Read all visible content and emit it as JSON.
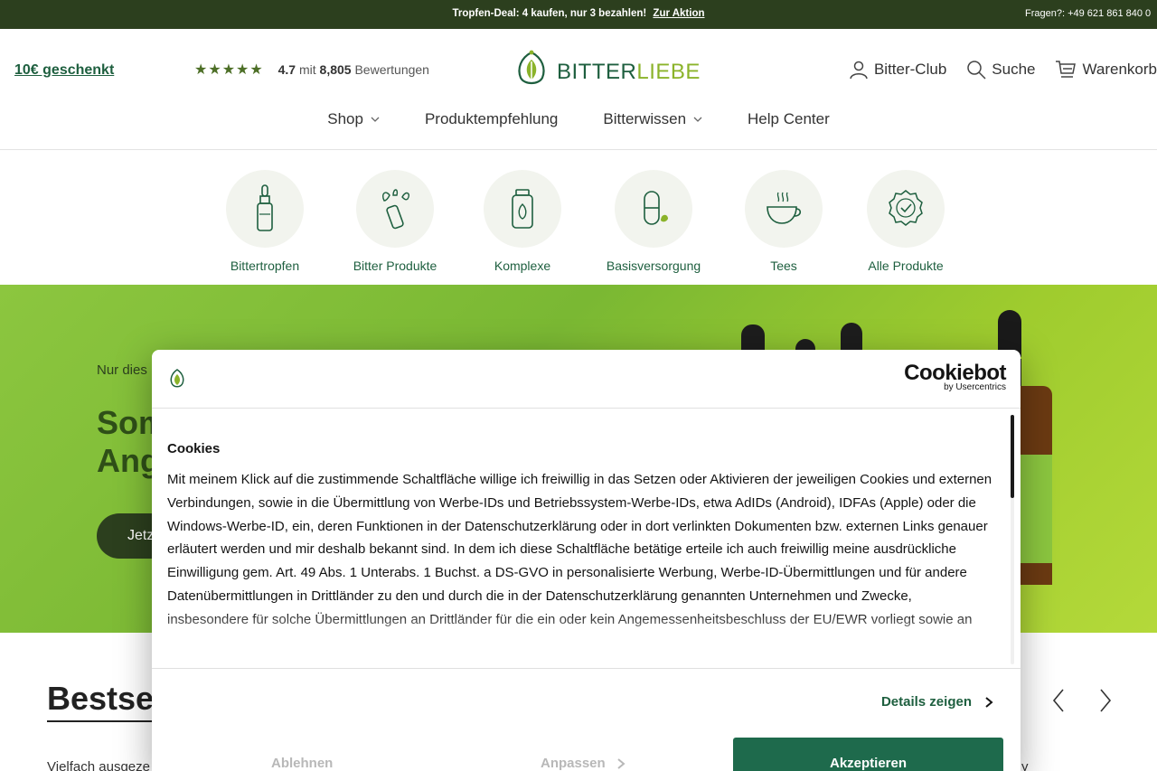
{
  "topbar": {
    "promo_text": "Tropfen-Deal: 4 kaufen, nur 3 bezahlen!",
    "promo_link": "Zur Aktion",
    "phone": "Fragen?: +49 621 861 840 0"
  },
  "header": {
    "gift_link": "10€ geschenkt",
    "rating_stars": "★★★★★",
    "rating_value": "4.7",
    "rating_mid": "mit",
    "rating_count": "8,805",
    "rating_suffix": "Bewertungen",
    "logo_part1": "BITTER",
    "logo_part2": "LIEBE",
    "actions": {
      "club": "Bitter-Club",
      "search": "Suche",
      "cart": "Warenkorb"
    },
    "nav": {
      "shop": "Shop",
      "recommendation": "Produktempfehlung",
      "knowledge": "Bitterwissen",
      "help": "Help Center"
    }
  },
  "categories": [
    {
      "label": "Bittertropfen",
      "icon": "dropper-bottle-icon"
    },
    {
      "label": "Bitter Produkte",
      "icon": "spray-leaves-icon"
    },
    {
      "label": "Komplexe",
      "icon": "jar-leaf-icon"
    },
    {
      "label": "Basisversorgung",
      "icon": "capsule-leaf-icon"
    },
    {
      "label": "Tees",
      "icon": "tea-cup-icon"
    },
    {
      "label": "Alle Produkte",
      "icon": "badge-check-icon"
    }
  ],
  "hero": {
    "eyebrow": "Nur dies",
    "headline_line1": "Som",
    "headline_line2": "Ang",
    "cta": "Jetz"
  },
  "bestseller": {
    "heading": "Bestsel",
    "subtext": "Vielfach ausgeze",
    "tail": "y"
  },
  "cookie_modal": {
    "brand": "Cookiebot",
    "brand_sub": "by Usercentrics",
    "title": "Cookies",
    "body": "Mit meinem Klick auf die zustimmende Schaltfläche willige ich freiwillig in das Setzen oder Aktivieren der jeweiligen Cookies und externen Verbindungen, sowie in die Übermittlung von Werbe-IDs und Betriebssystem-Werbe-IDs, etwa AdIDs (Android), IDFAs (Apple) oder die Windows-Werbe-ID, ein, deren Funktionen in der Datenschutzerklärung oder in dort verlinkten Dokumenten bzw. externen Links genauer erläutert werden und mir deshalb bekannt sind. In dem ich diese Schaltfläche betätige erteile ich auch freiwillig meine ausdrückliche Einwilligung gem. Art. 49 Abs. 1 Unterabs. 1 Buchst. a DS-GVO in personalisierte Werbung, Werbe-ID-Übermittlungen und für andere Datenübermittlungen in Drittländer zu den und durch die in der Datenschutzerklärung genannten Unternehmen und Zwecke, insbesondere für solche Übermittlungen an Drittländer für die ein oder kein Angemessenheitsbeschluss der EU/EWR vorliegt sowie an",
    "details": "Details zeigen",
    "decline": "Ablehnen",
    "customize": "Anpassen",
    "accept": "Akzeptieren"
  },
  "colors": {
    "brand_dark": "#2c3f1e",
    "brand_green": "#1e5f3f",
    "accent_lime": "#8bb32a",
    "accept_button": "#1e6a4c"
  }
}
